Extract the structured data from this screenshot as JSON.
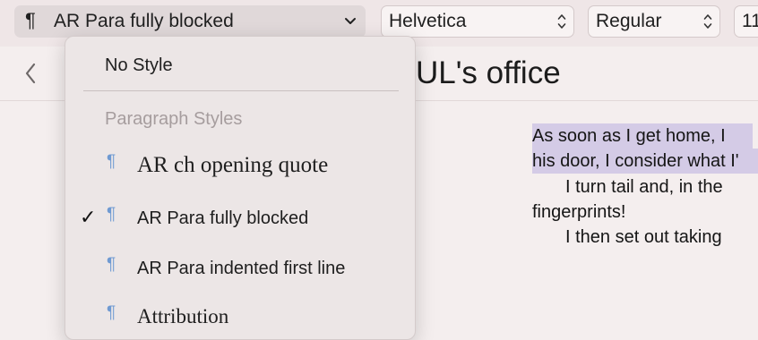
{
  "toolbar": {
    "paragraph_glyph": "¶",
    "style_popup": {
      "selected": "AR Para fully blocked",
      "chevron": "chevron-down-icon"
    },
    "font_popup": {
      "selected": "Helvetica"
    },
    "weight_popup": {
      "selected": "Regular"
    },
    "size_popup": {
      "selected": "11"
    }
  },
  "titlebar": {
    "title": "UL's office"
  },
  "menu": {
    "no_style_label": "No Style",
    "section_header": "Paragraph Styles",
    "pilcrow": "¶",
    "checkmark": "✓",
    "items": [
      {
        "label": "AR ch opening quote",
        "checked": false
      },
      {
        "label": "AR Para fully blocked",
        "checked": true
      },
      {
        "label": "AR Para indented first line",
        "checked": false
      },
      {
        "label": "Attribution",
        "checked": false
      }
    ]
  },
  "document": {
    "lines": [
      "As soon as I get home, I",
      "his door, I consider what I'",
      "I turn tail and, in the",
      "fingerprints!",
      "I then set out taking"
    ]
  },
  "colors": {
    "accent": "#6f9ad2",
    "selection": "#d4cbe6",
    "toolbar_bg": "#efe6e7",
    "menu_bg": "#ece6e6"
  }
}
